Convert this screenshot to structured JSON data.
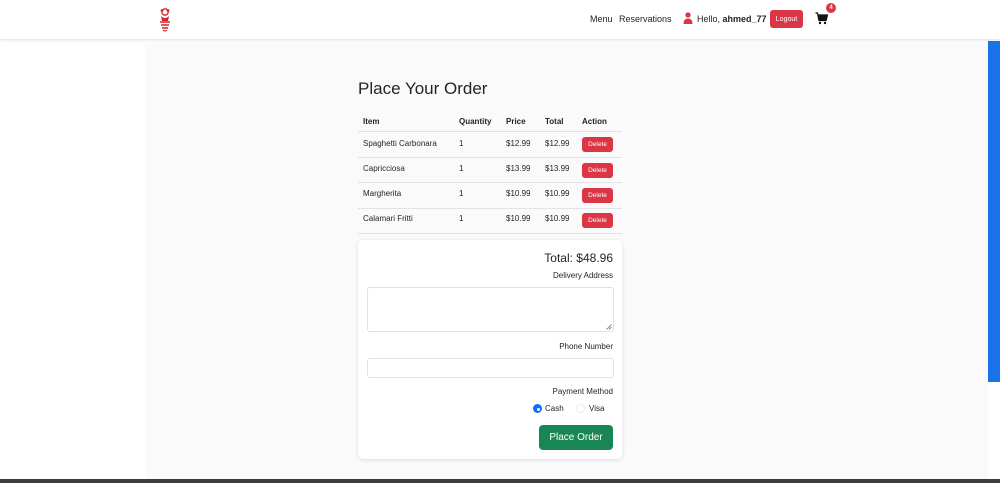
{
  "nav": {
    "menu": "Menu",
    "reservations": "Reservations",
    "hello_prefix": "Hello,",
    "username": "ahmed_77",
    "logout": "Logout",
    "cart_count": "4"
  },
  "order": {
    "title": "Place Your Order",
    "columns": [
      "Item",
      "Quantity",
      "Price",
      "Total",
      "Action"
    ],
    "rows": [
      {
        "item": "Spaghetti Carbonara",
        "quantity": "1",
        "price": "$12.99",
        "total": "$12.99",
        "action": "Delete"
      },
      {
        "item": "Capricciosa",
        "quantity": "1",
        "price": "$13.99",
        "total": "$13.99",
        "action": "Delete"
      },
      {
        "item": "Margherita",
        "quantity": "1",
        "price": "$10.99",
        "total": "$10.99",
        "action": "Delete"
      },
      {
        "item": "Calamari Fritti",
        "quantity": "1",
        "price": "$10.99",
        "total": "$10.99",
        "action": "Delete"
      }
    ],
    "total_label": "Total: $48.96",
    "delivery_label": "Delivery Address",
    "delivery_value": "",
    "phone_label": "Phone Number",
    "phone_value": "",
    "payment_label": "Payment Method",
    "payment_options": [
      "Cash",
      "Visa"
    ],
    "payment_selected": "Cash",
    "submit": "Place Order"
  },
  "colors": {
    "danger": "#dc3545",
    "success": "#198754",
    "primary": "#0d6efd"
  },
  "icons": {
    "logo": "restaurant-logo-icon",
    "user": "user-icon",
    "cart": "cart-icon"
  }
}
